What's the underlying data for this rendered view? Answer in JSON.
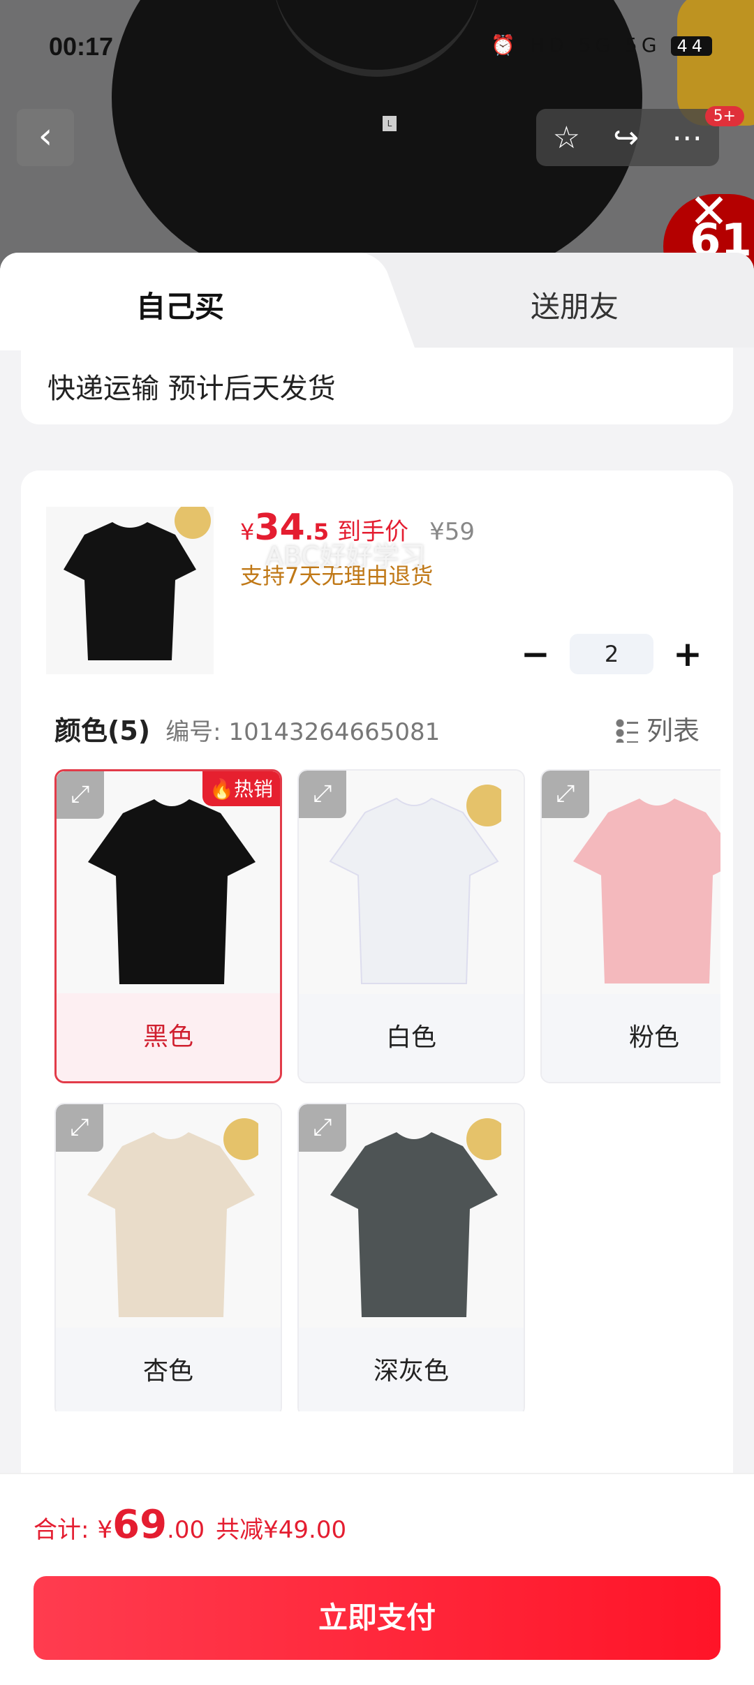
{
  "status_bar": {
    "time": "00:17",
    "icons": "⏰ HD 5G 5G",
    "battery": "44"
  },
  "nav": {
    "back_icon": "chevron-left-icon",
    "badge": "5+"
  },
  "tabs": {
    "self": "自己买",
    "gift": "送朋友"
  },
  "shipping": {
    "text": "快递运输 预计后天发货"
  },
  "product": {
    "currency": "¥",
    "price_int": "34",
    "price_dec": ".5",
    "price_label": "到手价",
    "original_price": "¥59",
    "return_policy": "支持7天无理由退货",
    "quantity": "2"
  },
  "colors": {
    "title": "颜色(5)",
    "sku": "编号: 10143264665081",
    "list_toggle": "列表",
    "hot_badge": "热销",
    "watermark": "ABC好好学习",
    "items": [
      {
        "label": "黑色",
        "selected": true,
        "swatch": "#111111"
      },
      {
        "label": "白色",
        "selected": false,
        "swatch": "#eef0f4"
      },
      {
        "label": "粉色",
        "selected": false,
        "swatch": "#f4b9bd"
      },
      {
        "label": "杏色",
        "selected": false,
        "swatch": "#e9dcc9"
      },
      {
        "label": "深灰色",
        "selected": false,
        "swatch": "#4e5455"
      }
    ]
  },
  "summary": {
    "label": "合计:",
    "currency": "¥",
    "int": "69",
    "dec": ".00",
    "discount": "共减¥49.00"
  },
  "pay_button": "立即支付",
  "accent": "#e41d30"
}
